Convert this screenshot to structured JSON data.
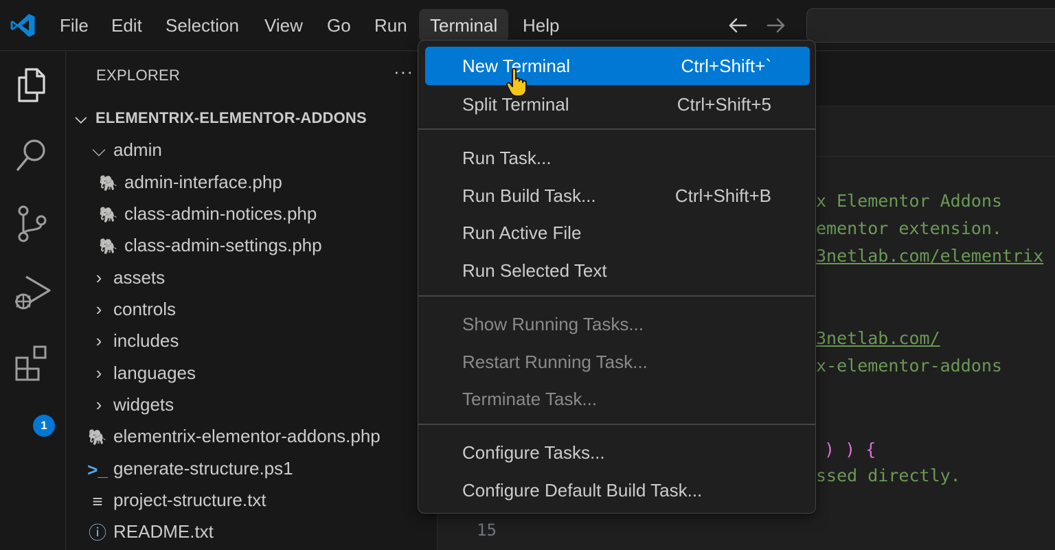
{
  "menubar": {
    "items": [
      "File",
      "Edit",
      "Selection",
      "View",
      "Go",
      "Run",
      "Terminal",
      "Help"
    ],
    "active": "Terminal",
    "back_icon": "arrow-left-icon",
    "forward_icon": "arrow-right-icon"
  },
  "activitybar": {
    "icons": [
      "files-icon",
      "search-icon",
      "source-control-icon",
      "run-debug-icon",
      "extensions-icon"
    ],
    "extensions_badge": "1"
  },
  "explorer": {
    "title": "EXPLORER",
    "more": "···",
    "root": "ELEMENTRIX-ELEMENTOR-ADDONS",
    "items": [
      {
        "label": "admin",
        "kind": "folder-open"
      },
      {
        "label": "admin-interface.php",
        "kind": "php"
      },
      {
        "label": "class-admin-notices.php",
        "kind": "php"
      },
      {
        "label": "class-admin-settings.php",
        "kind": "php"
      },
      {
        "label": "assets",
        "kind": "folder"
      },
      {
        "label": "controls",
        "kind": "folder"
      },
      {
        "label": "includes",
        "kind": "folder"
      },
      {
        "label": "languages",
        "kind": "folder"
      },
      {
        "label": "widgets",
        "kind": "folder"
      },
      {
        "label": "elementrix-elementor-addons.php",
        "kind": "php"
      },
      {
        "label": "generate-structure.ps1",
        "kind": "powershell"
      },
      {
        "label": "project-structure.txt",
        "kind": "text"
      },
      {
        "label": "README.txt",
        "kind": "info"
      }
    ]
  },
  "editor": {
    "lines": [
      "x Elementor Addons",
      "ementor extension.",
      "3netlab.com/elementrix",
      "3netlab.com/",
      "x-elementor-addons",
      ") ) {",
      "ssed directly."
    ],
    "line_number": "15"
  },
  "terminal_menu": {
    "items": [
      {
        "label": "New Terminal",
        "shortcut": "Ctrl+Shift+`"
      },
      {
        "label": "Split Terminal",
        "shortcut": "Ctrl+Shift+5"
      },
      {
        "label": "Run Task...",
        "shortcut": ""
      },
      {
        "label": "Run Build Task...",
        "shortcut": "Ctrl+Shift+B"
      },
      {
        "label": "Run Active File",
        "shortcut": ""
      },
      {
        "label": "Run Selected Text",
        "shortcut": ""
      },
      {
        "label": "Show Running Tasks...",
        "shortcut": ""
      },
      {
        "label": "Restart Running Task...",
        "shortcut": ""
      },
      {
        "label": "Terminate Task...",
        "shortcut": ""
      },
      {
        "label": "Configure Tasks...",
        "shortcut": ""
      },
      {
        "label": "Configure Default Build Task...",
        "shortcut": ""
      }
    ]
  },
  "colors": {
    "accent": "#0078d4",
    "comment": "#6a9955",
    "php_icon": "#a074c4"
  }
}
